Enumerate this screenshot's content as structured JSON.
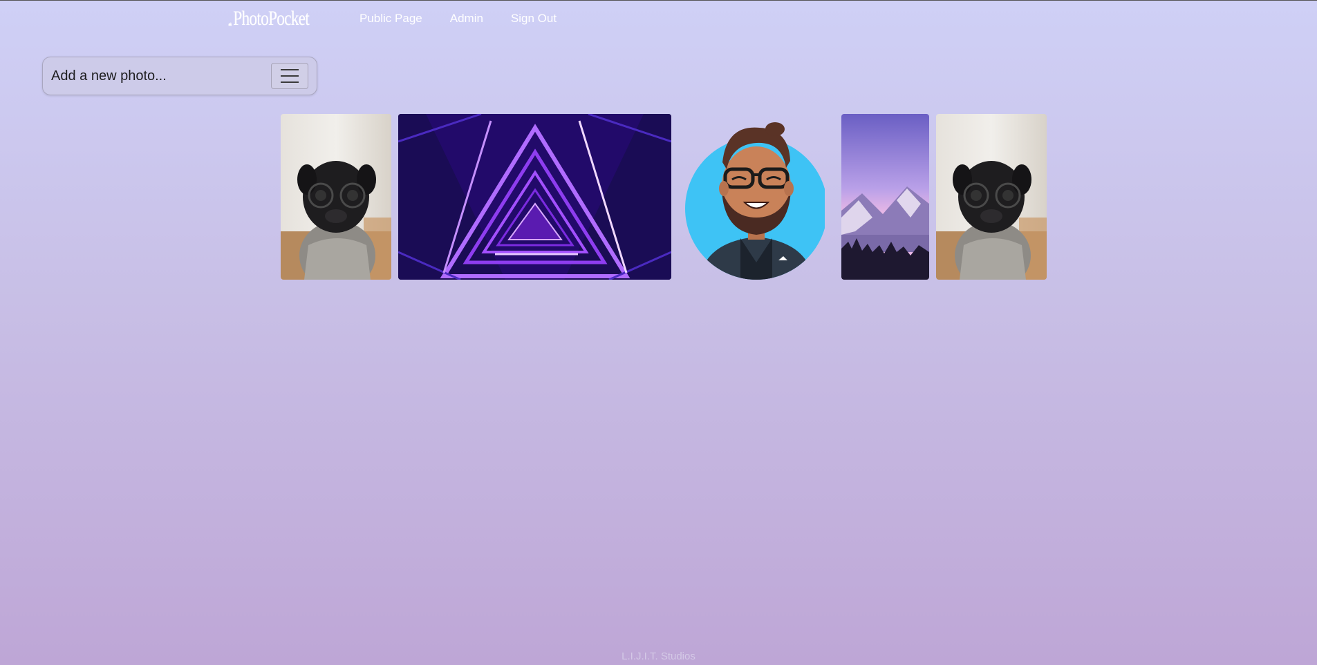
{
  "nav": {
    "brand": "PhotoPocket",
    "links": [
      "Public Page",
      "Admin",
      "Sign Out"
    ]
  },
  "add_photo": {
    "placeholder_label": "Add a new photo..."
  },
  "gallery": {
    "photos": [
      {
        "subject": "pug-with-glasses"
      },
      {
        "subject": "neon-purple-triangle-tunnel"
      },
      {
        "subject": "cartoon-bearded-man-avatar"
      },
      {
        "subject": "purple-mountain-lake"
      },
      {
        "subject": "pug-with-glasses"
      }
    ]
  },
  "footer": {
    "text": "L.I.J.I.T. Studios"
  },
  "colors": {
    "background_top": "#cfd0f6",
    "background_bottom": "#bea6d6",
    "nav_text": "#ffffff"
  }
}
